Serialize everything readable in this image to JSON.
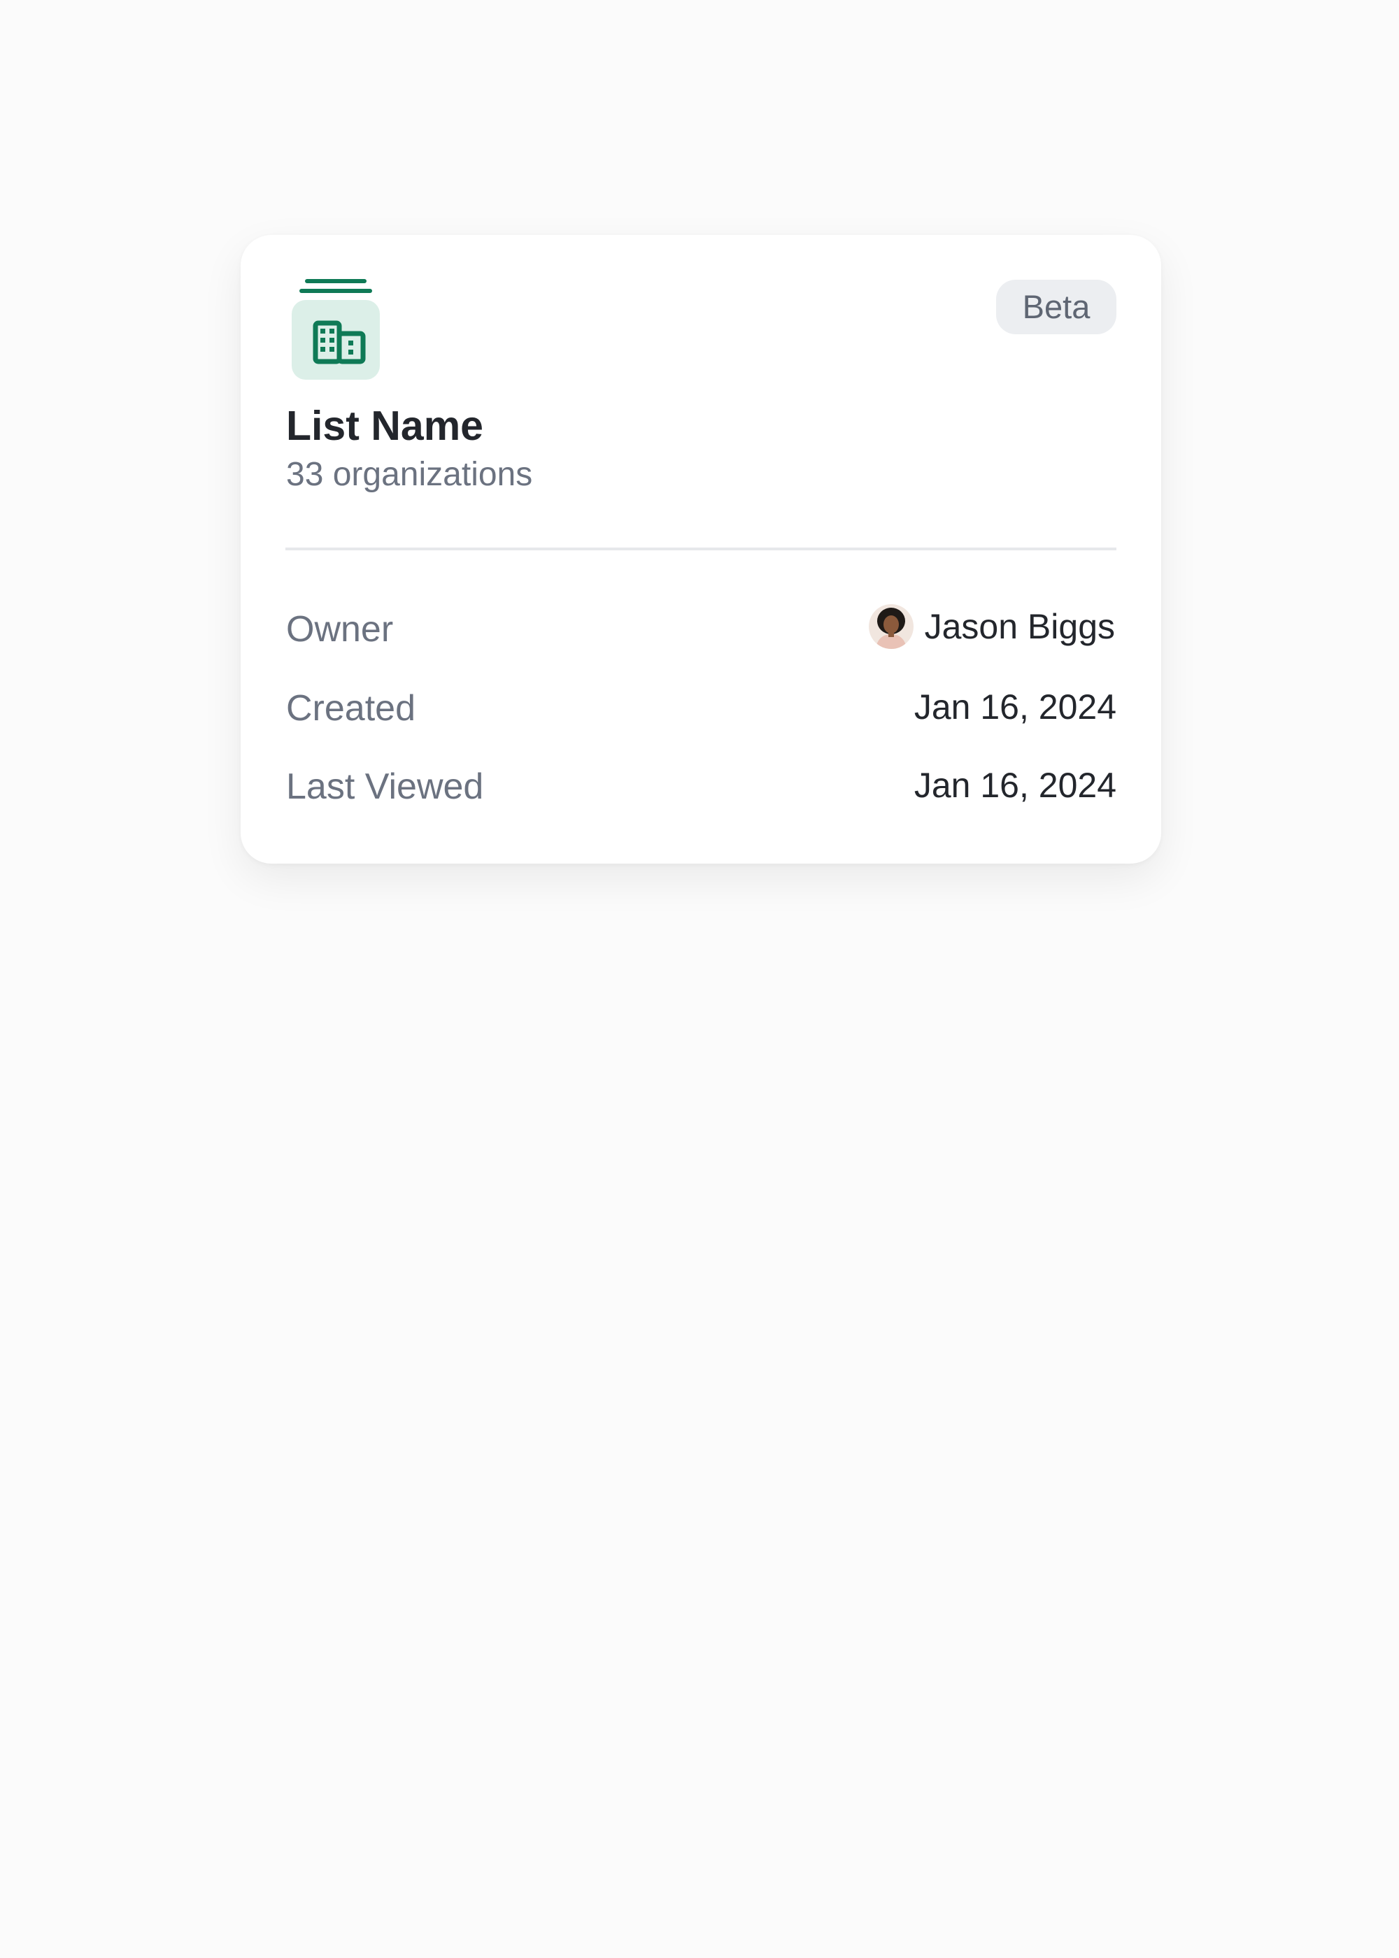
{
  "list": {
    "icon": "building-list-icon",
    "badge": "Beta",
    "title": "List Name",
    "subtitle": "33 organizations"
  },
  "details": {
    "owner_label": "Owner",
    "owner_name": "Jason Biggs",
    "owner_avatar": "avatar",
    "created_label": "Created",
    "created_value": "Jan 16, 2024",
    "last_viewed_label": "Last Viewed",
    "last_viewed_value": "Jan 16, 2024"
  },
  "colors": {
    "accent": "#0f7a56",
    "icon_background": "#dcefe8",
    "badge_background": "#eceef1",
    "text_primary": "#23262c",
    "text_secondary": "#6b7280"
  }
}
